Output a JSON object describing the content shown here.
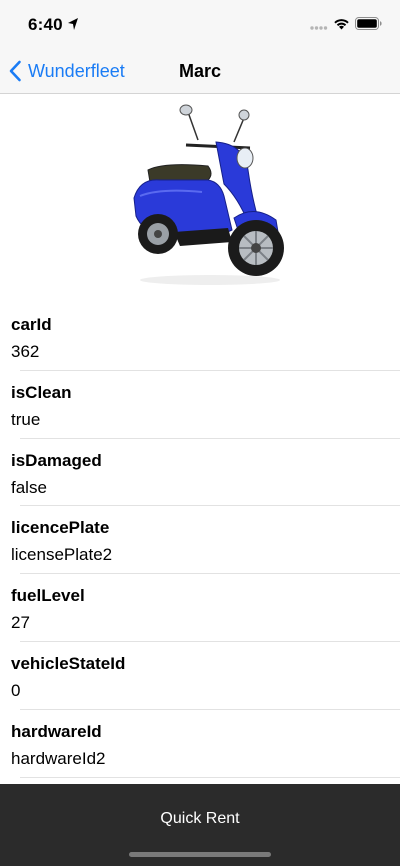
{
  "status_bar": {
    "time": "6:40"
  },
  "nav": {
    "back_label": "Wunderfleet",
    "title": "Marc"
  },
  "vehicle_image": {
    "icon": "scooter-image",
    "color": "#2a3ad9"
  },
  "fields": [
    {
      "label": "carId",
      "value": "362"
    },
    {
      "label": "isClean",
      "value": "true"
    },
    {
      "label": "isDamaged",
      "value": "false"
    },
    {
      "label": "licencePlate",
      "value": "licensePlate2"
    },
    {
      "label": "fuelLevel",
      "value": "27"
    },
    {
      "label": "vehicleStateId",
      "value": "0"
    },
    {
      "label": "hardwareId",
      "value": "hardwareId2"
    }
  ],
  "bottom": {
    "button_label": "Quick Rent"
  },
  "colors": {
    "accent": "#1a7cf5",
    "bottom_bar": "#2b2b2b"
  }
}
